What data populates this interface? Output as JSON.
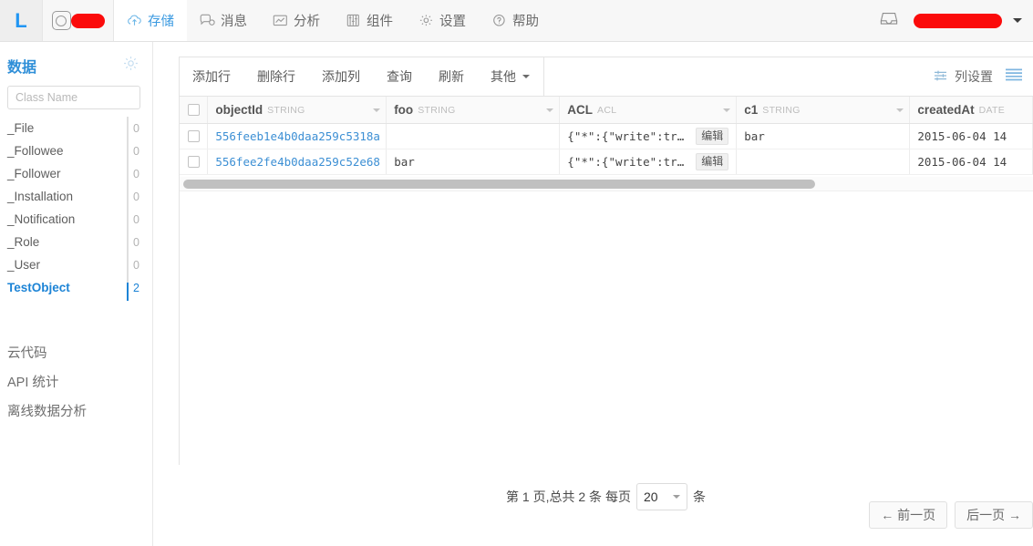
{
  "topnav": {
    "logo_text": "L",
    "app_badge_redacted": true,
    "tabs": [
      {
        "label": "存储",
        "icon": "cloud-upload-icon",
        "active": true
      },
      {
        "label": "消息",
        "icon": "chat-icon",
        "active": false
      },
      {
        "label": "分析",
        "icon": "chart-icon",
        "active": false
      },
      {
        "label": "组件",
        "icon": "sliders-icon",
        "active": false
      },
      {
        "label": "设置",
        "icon": "gear-icon",
        "active": false
      },
      {
        "label": "帮助",
        "icon": "question-circle-icon",
        "active": false
      }
    ],
    "inbox_icon": "inbox-icon",
    "user_menu_redacted": true
  },
  "sidebar": {
    "title": "数据",
    "settings_icon": "gear-icon",
    "search": {
      "value": "",
      "placeholder": "Class Name"
    },
    "classes": [
      {
        "name": "_File",
        "count": "0",
        "active": false
      },
      {
        "name": "_Followee",
        "count": "0",
        "active": false
      },
      {
        "name": "_Follower",
        "count": "0",
        "active": false
      },
      {
        "name": "_Installation",
        "count": "0",
        "active": false
      },
      {
        "name": "_Notification",
        "count": "0",
        "active": false
      },
      {
        "name": "_Role",
        "count": "0",
        "active": false
      },
      {
        "name": "_User",
        "count": "0",
        "active": false
      },
      {
        "name": "TestObject",
        "count": "2",
        "active": true
      }
    ],
    "links": [
      {
        "label": "云代码"
      },
      {
        "label": "API 统计"
      },
      {
        "label": "离线数据分析"
      }
    ]
  },
  "toolbar": {
    "buttons": [
      {
        "label": "添加行"
      },
      {
        "label": "删除行"
      },
      {
        "label": "添加列"
      },
      {
        "label": "查询"
      },
      {
        "label": "刷新"
      }
    ],
    "more_label": "其他",
    "column_settings_label": "列设置",
    "column_settings_icon": "sliders-icon",
    "list_view_icon": "list-icon"
  },
  "table": {
    "columns": [
      {
        "name": "objectId",
        "type": "STRING"
      },
      {
        "name": "foo",
        "type": "STRING"
      },
      {
        "name": "ACL",
        "type": "ACL"
      },
      {
        "name": "c1",
        "type": "STRING"
      },
      {
        "name": "createdAt",
        "type": "DATE"
      }
    ],
    "edit_label": "编辑",
    "rows": [
      {
        "objectId": "556feeb1e4b0daa259c5318a",
        "foo": "",
        "acl": "{\"*\":{\"write\":true,\"…",
        "c1": "bar",
        "createdAt": "2015-06-04 14"
      },
      {
        "objectId": "556fee2fe4b0daa259c52e68",
        "foo": "bar",
        "acl": "{\"*\":{\"write\":true,\"…",
        "c1": "",
        "createdAt": "2015-06-04 14"
      }
    ]
  },
  "footer": {
    "page_text_prefix": "第 1 页,总共 2 条 每页",
    "per_page_value": "20",
    "page_text_suffix": "条",
    "prev_label": "← 前一页",
    "next_label": "后一页 →"
  },
  "colors": {
    "accent": "#3b9ae1",
    "link": "#3c8fd4",
    "redaction": "#fb0b0b"
  }
}
